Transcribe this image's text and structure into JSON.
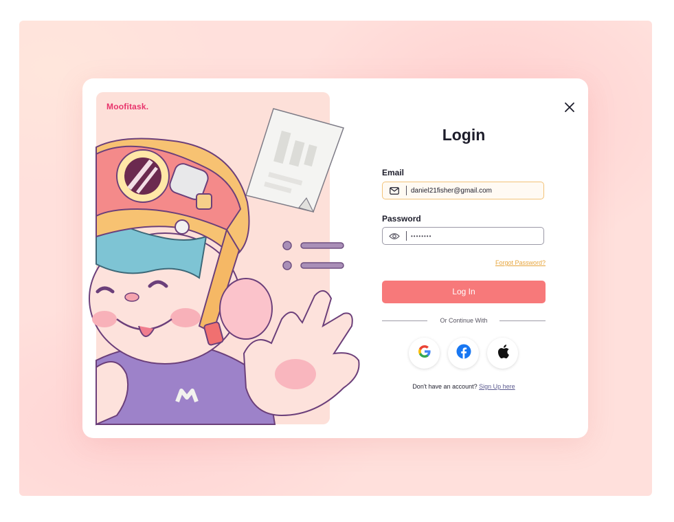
{
  "brand": {
    "name": "Moofitask."
  },
  "login": {
    "title": "Login",
    "email_label": "Email",
    "email_value": "daniel21fisher@gmail.com",
    "password_label": "Password",
    "password_value": "••••••••",
    "forgot_label": "Forgot Password?",
    "submit_label": "Log In",
    "divider_text": "Or Continue With",
    "social": [
      "google-icon",
      "facebook-icon",
      "apple-icon"
    ],
    "signup_prompt": "Don't have an account?",
    "signup_link": "Sign Up here"
  },
  "icons": {
    "close": "close-icon",
    "email": "mail-icon",
    "password": "eye-icon"
  },
  "colors": {
    "accent": "#f7797a",
    "brand": "#e8336b",
    "link_orange": "#e7a43a",
    "email_border": "#f2c277",
    "backdrop": "#ffe0dc"
  }
}
